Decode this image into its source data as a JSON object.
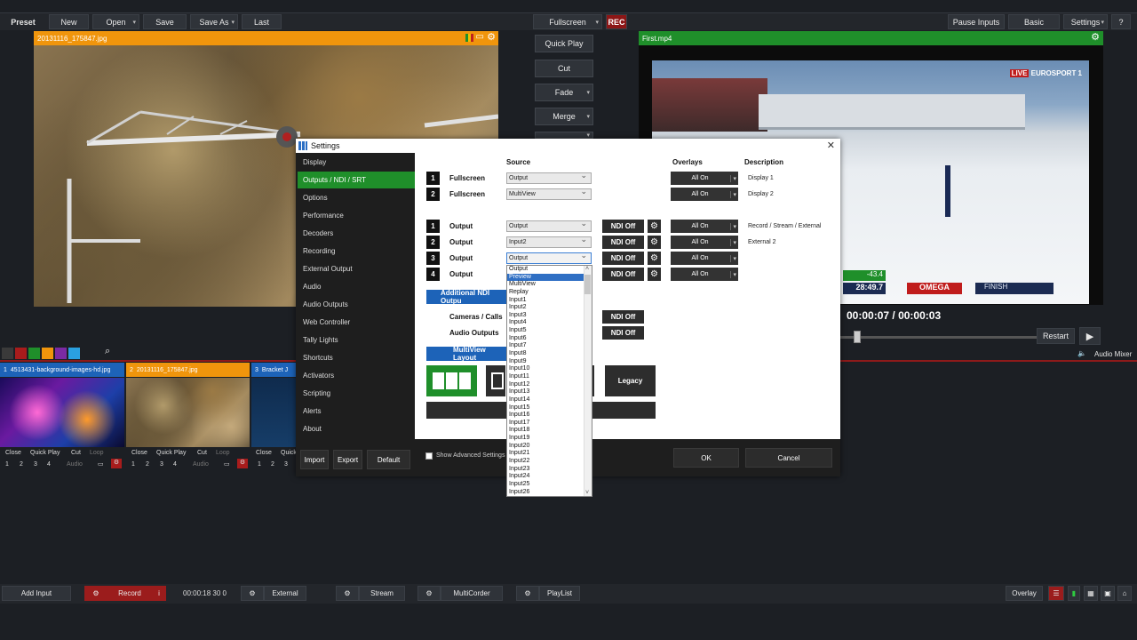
{
  "toolbar": {
    "preset": "Preset",
    "new": "New",
    "open": "Open",
    "save": "Save",
    "save_as": "Save As",
    "last": "Last",
    "fullscreen": "Fullscreen",
    "rec": "REC",
    "pause_inputs": "Pause Inputs",
    "basic": "Basic",
    "settings": "Settings",
    "help": "?"
  },
  "preview": {
    "title": "20131116_175847.jpg"
  },
  "output": {
    "title": "First.mp4",
    "time_current": "00:00:07",
    "time_sep": "/",
    "time_total": "00:00:03",
    "restart": "Restart",
    "audio_mixer": "Audio Mixer",
    "overlay_score": "-43.4",
    "overlay_time": "28:49.7",
    "overlay_brand": "OMEGA",
    "overlay_finish": "FINISH",
    "overlay_channel": "EUROSPORT 1",
    "overlay_live": "LIVE"
  },
  "transitions": {
    "quick_play": "Quick Play",
    "cut": "Cut",
    "fade": "Fade",
    "merge": "Merge"
  },
  "colors": {
    "orange": "#f0950c",
    "green": "#1f8f2a",
    "red": "#8c1616",
    "blue": "#1d63b8"
  },
  "settings": {
    "title": "Settings",
    "nav": [
      "Display",
      "Outputs / NDI / SRT",
      "Options",
      "Performance",
      "Decoders",
      "Recording",
      "External Output",
      "Audio",
      "Audio Outputs",
      "Web Controller",
      "Tally Lights",
      "Shortcuts",
      "Activators",
      "Scripting",
      "Alerts",
      "About"
    ],
    "nav_buttons": {
      "import": "Import",
      "export": "Export",
      "default": "Default"
    },
    "headers": {
      "source": "Source",
      "overlays": "Overlays",
      "description": "Description"
    },
    "fullscreen_rows": [
      {
        "num": "1",
        "label": "Fullscreen",
        "source": "Output",
        "overlay": "All On",
        "desc": "Display 1"
      },
      {
        "num": "2",
        "label": "Fullscreen",
        "source": "MultiView",
        "overlay": "All On",
        "desc": "Display 2"
      }
    ],
    "output_rows": [
      {
        "num": "1",
        "label": "Output",
        "source": "Output",
        "ndi": "NDI Off",
        "overlay": "All On",
        "desc": "Record / Stream / External"
      },
      {
        "num": "2",
        "label": "Output",
        "source": "Input2",
        "ndi": "NDI Off",
        "overlay": "All On",
        "desc": "External 2"
      },
      {
        "num": "3",
        "label": "Output",
        "source": "Output",
        "ndi": "NDI Off",
        "overlay": "All On",
        "desc": ""
      },
      {
        "num": "4",
        "label": "Output",
        "source": "",
        "ndi": "NDI Off",
        "overlay": "All On",
        "desc": ""
      }
    ],
    "additional_ndi": "Additional NDI Outpu",
    "cameras_calls": "Cameras / Calls",
    "audio_outputs": "Audio Outputs",
    "cameras_ndi": "NDI Off",
    "audio_ndi": "NDI Off",
    "multiview_layout": "MultiView Layout",
    "legacy": "Legacy",
    "show_advanced": "Show Advanced Settings",
    "ok": "OK",
    "cancel": "Cancel",
    "dropdown_options": [
      "Output",
      "Preview",
      "MultiView",
      "Replay",
      "Input1",
      "Input2",
      "Input3",
      "Input4",
      "Input5",
      "Input6",
      "Input7",
      "Input8",
      "Input9",
      "Input10",
      "Input11",
      "Input12",
      "Input13",
      "Input14",
      "Input15",
      "Input16",
      "Input17",
      "Input18",
      "Input19",
      "Input20",
      "Input21",
      "Input22",
      "Input23",
      "Input24",
      "Input25",
      "Input26"
    ],
    "dropdown_highlight": "Preview"
  },
  "inputs": [
    {
      "num": "1",
      "title": "4513431-background-images-hd.jpg",
      "close": "Close",
      "quick_play": "Quick Play",
      "cut": "Cut",
      "loop": "Loop",
      "audio": "Audio",
      "n1": "1",
      "n2": "2",
      "n3": "3",
      "n4": "4"
    },
    {
      "num": "2",
      "title": "20131116_175847.jpg",
      "close": "Close",
      "quick_play": "Quick Play",
      "cut": "Cut",
      "loop": "Loop",
      "audio": "Audio",
      "n1": "1",
      "n2": "2",
      "n3": "3",
      "n4": "4"
    },
    {
      "num": "3",
      "title": "Bracket J",
      "close": "Close",
      "quick_play": "Quick",
      "n1": "1",
      "n2": "2",
      "n3": "3"
    }
  ],
  "bottom": {
    "add_input": "Add Input",
    "record": "Record",
    "record_info": "i",
    "record_time": "00:00:18 30 0",
    "external": "External",
    "stream": "Stream",
    "multicorder": "MultiCorder",
    "playlist": "PlayList",
    "overlay": "Overlay"
  }
}
